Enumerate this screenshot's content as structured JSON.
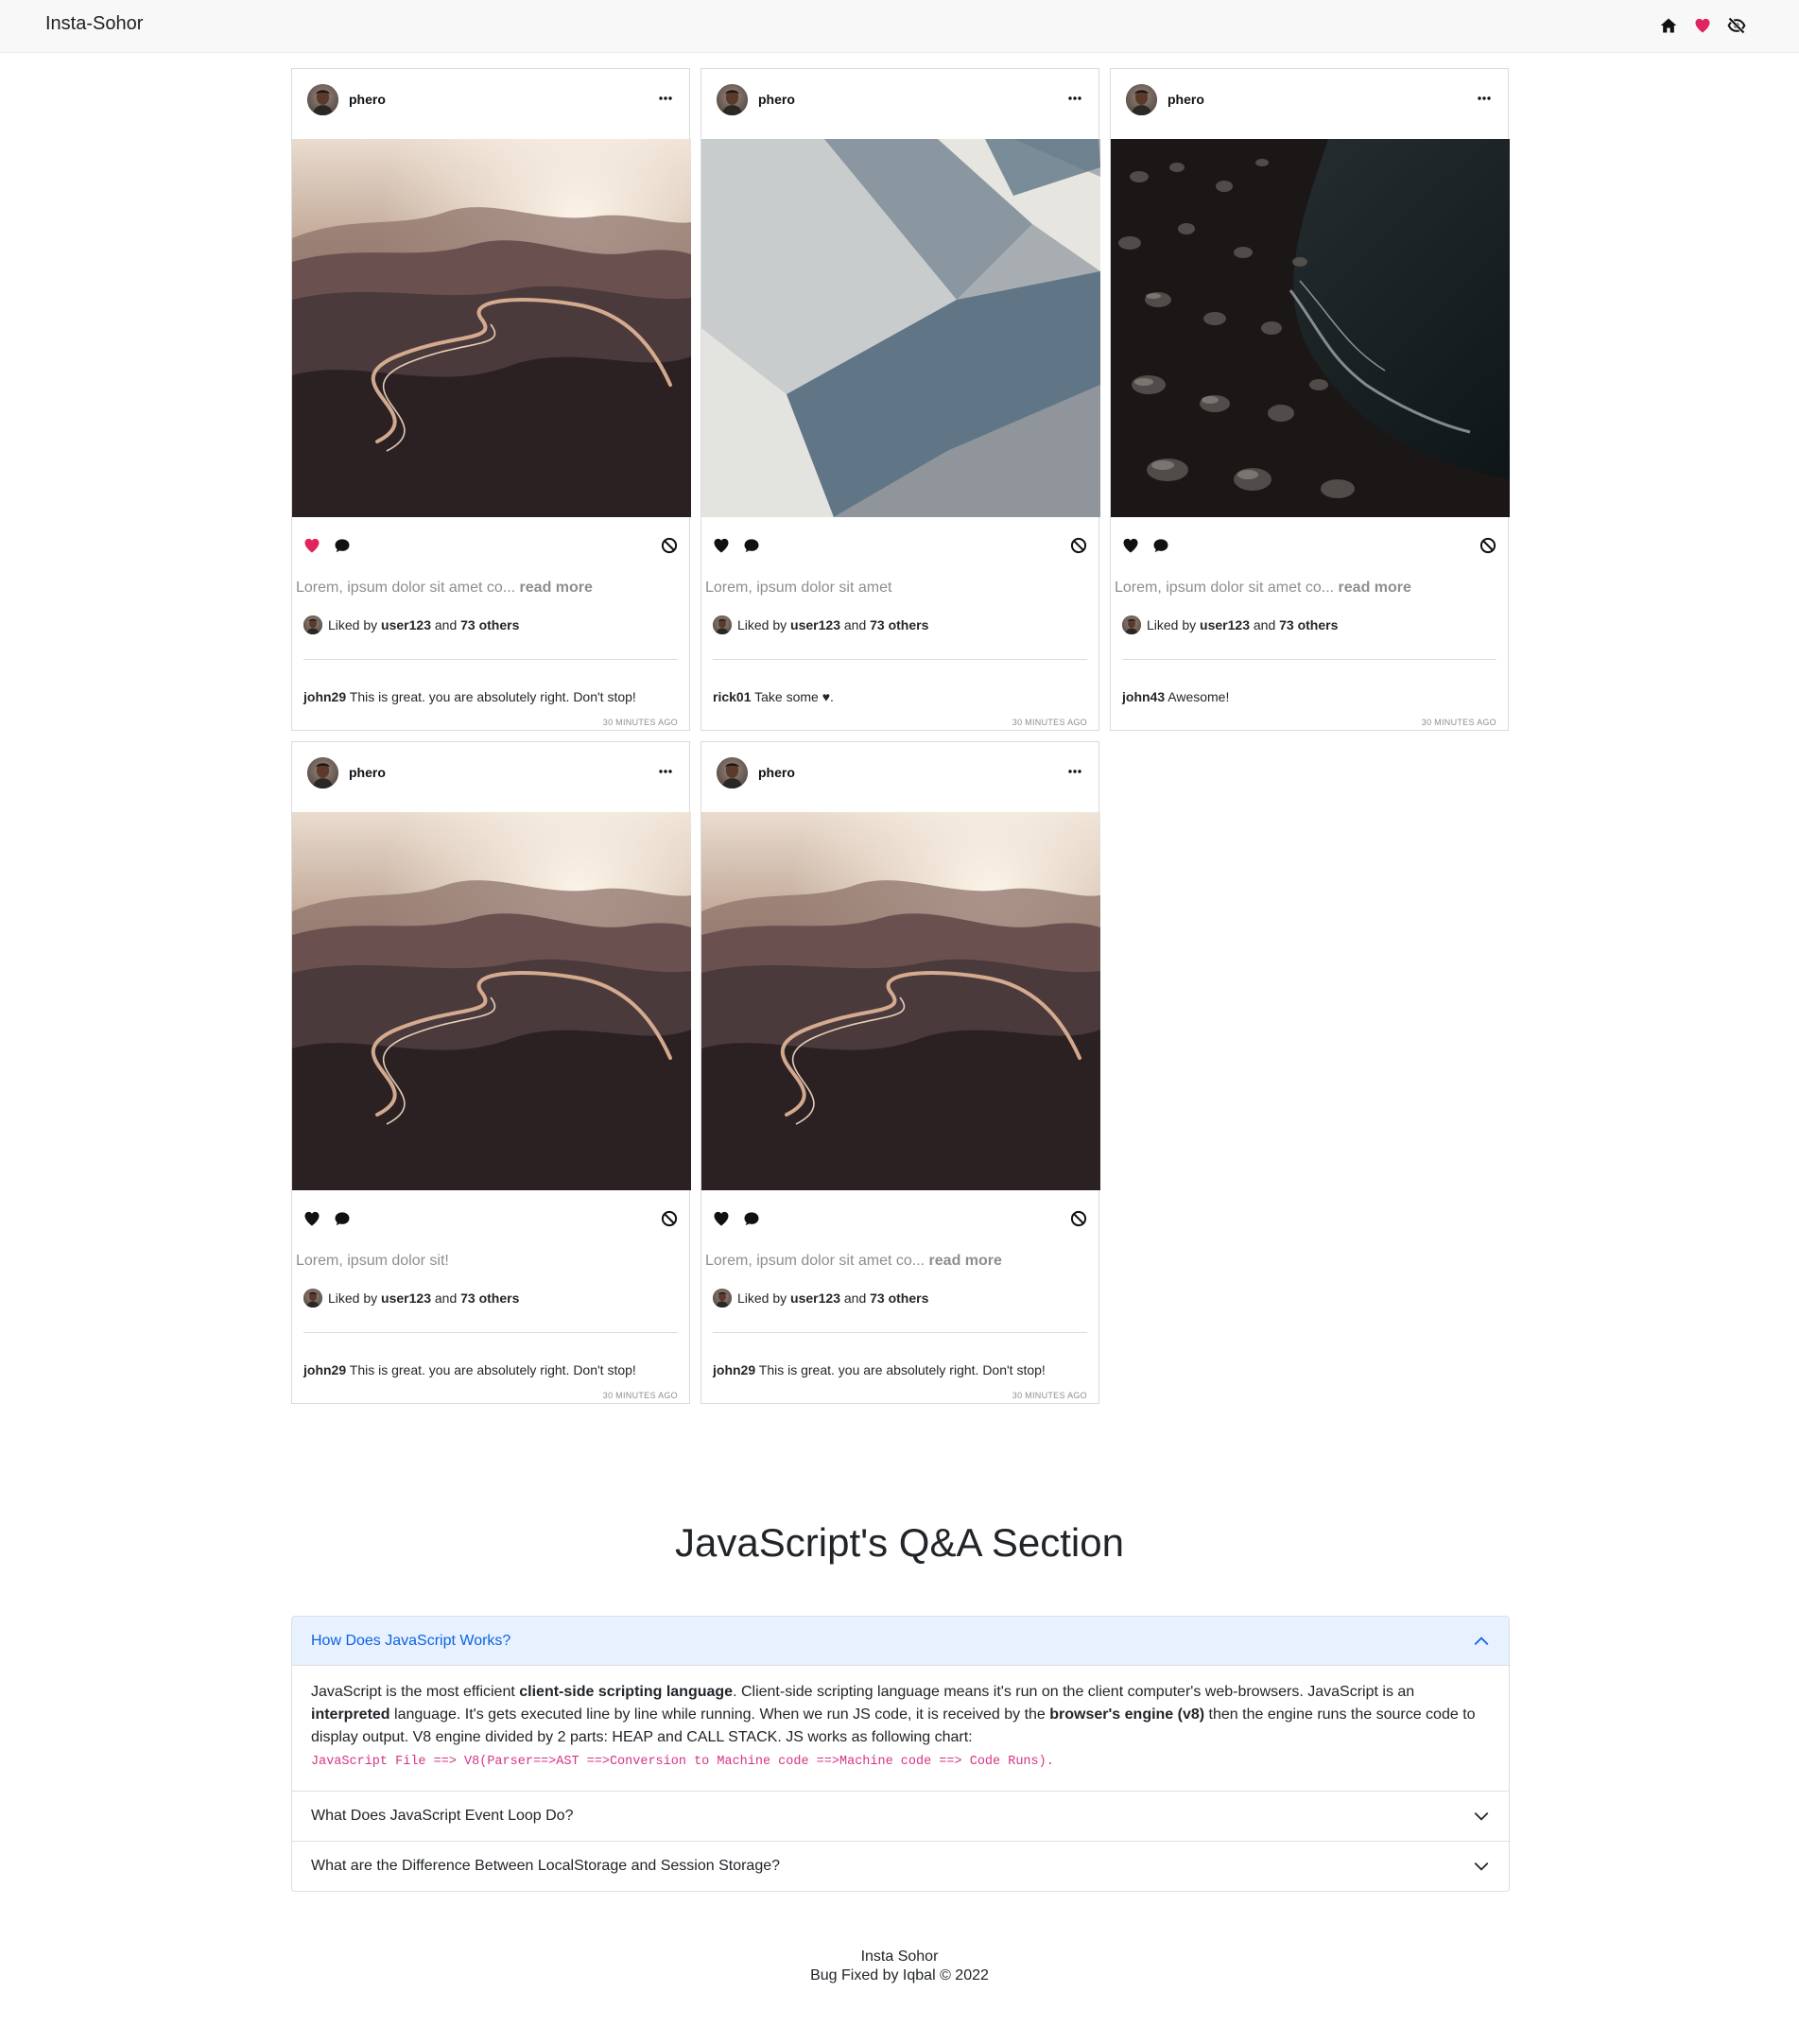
{
  "navbar": {
    "brand": "Insta-Sohor",
    "icons": [
      "home-icon",
      "heart-icon",
      "eye-slash-icon"
    ],
    "heart_color": "#e0245e"
  },
  "posts": [
    {
      "username": "phero",
      "image": "winding-road",
      "liked": true,
      "caption": "Lorem, ipsum dolor sit amet co...",
      "read_more": "read more",
      "likes_prefix": "Liked by",
      "likes_user": "user123",
      "likes_and": "and",
      "likes_others": "73 others",
      "comment_user": "john29",
      "comment_text": "This is great. you are absolutely right. Don't stop!",
      "time": "30 MINUTES AGO"
    },
    {
      "username": "phero",
      "image": "abstract-geometry",
      "liked": false,
      "caption": "Lorem, ipsum dolor sit amet",
      "read_more": "",
      "likes_prefix": "Liked by",
      "likes_user": "user123",
      "likes_and": "and",
      "likes_others": "73 others",
      "comment_user": "rick01",
      "comment_text": "Take some ♥.",
      "time": "30 MINUTES AGO"
    },
    {
      "username": "phero",
      "image": "pebbles-water",
      "liked": false,
      "caption": "Lorem, ipsum dolor sit amet co...",
      "read_more": "read more",
      "likes_prefix": "Liked by",
      "likes_user": "user123",
      "likes_and": "and",
      "likes_others": "73 others",
      "comment_user": "john43",
      "comment_text": "Awesome!",
      "time": "30 MINUTES AGO"
    },
    {
      "username": "phero",
      "image": "winding-road",
      "liked": false,
      "caption": "Lorem, ipsum dolor sit!",
      "read_more": "",
      "likes_prefix": "Liked by",
      "likes_user": "user123",
      "likes_and": "and",
      "likes_others": "73 others",
      "comment_user": "john29",
      "comment_text": "This is great. you are absolutely right. Don't stop!",
      "time": "30 MINUTES AGO"
    },
    {
      "username": "phero",
      "image": "winding-road",
      "liked": false,
      "caption": "Lorem, ipsum dolor sit amet co...",
      "read_more": "read more",
      "likes_prefix": "Liked by",
      "likes_user": "user123",
      "likes_and": "and",
      "likes_others": "73 others",
      "comment_user": "john29",
      "comment_text": "This is great. you are absolutely right. Don't stop!",
      "time": "30 MINUTES AGO"
    }
  ],
  "qa": {
    "title": "JavaScript's Q&A Section",
    "items": [
      {
        "question": "How Does JavaScript Works?",
        "open": true,
        "answer_parts": [
          {
            "t": "JavaScript is the most efficient ",
            "b": false
          },
          {
            "t": "client-side scripting language",
            "b": true
          },
          {
            "t": ". Client-side scripting language means it's run on the client computer's web-browsers. JavaScript is an ",
            "b": false
          },
          {
            "t": "interpreted",
            "b": true
          },
          {
            "t": " language. It's gets executed line by line while running. When we run JS code, it is received by the ",
            "b": false
          },
          {
            "t": "browser's engine (v8)",
            "b": true
          },
          {
            "t": " then the engine runs the source code to display output. V8 engine divided by 2 parts: HEAP and CALL STACK. JS works as following chart:",
            "b": false
          }
        ],
        "code": "JavaScript File ==> V8(Parser==>AST ==>Conversion to Machine code ==>Machine code ==> Code Runs)."
      },
      {
        "question": "What Does JavaScript Event Loop Do?",
        "open": false
      },
      {
        "question": "What are the Difference Between LocalStorage and Session Storage?",
        "open": false
      }
    ],
    "accent_color": "#0c63e4",
    "open_bg": "#e7f1ff",
    "code_color": "#d63384"
  },
  "footer": {
    "line1": "Insta Sohor",
    "line2": "Bug Fixed by Iqbal © 2022"
  }
}
